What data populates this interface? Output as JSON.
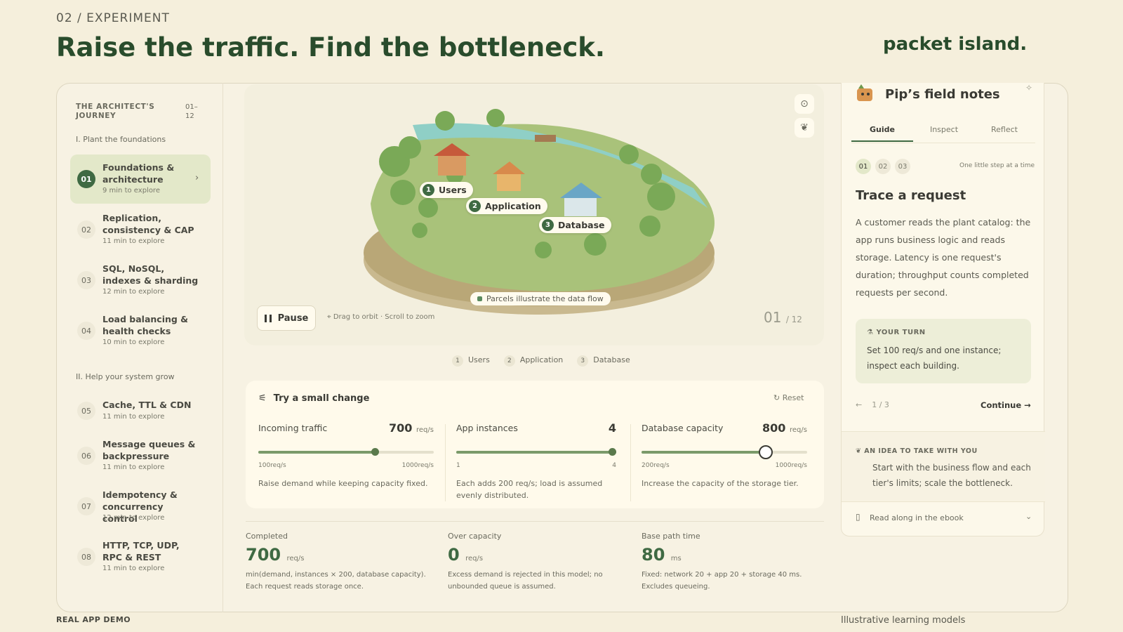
{
  "header": {
    "kicker": "02 / EXPERIMENT",
    "headline": "Raise the traffic. Find the bottleneck.",
    "brand": "packet island."
  },
  "sidebar": {
    "title": "THE ARCHITECT'S JOURNEY",
    "count": "01–12",
    "sections": [
      {
        "label": "I. Plant the foundations"
      },
      {
        "label": "II. Help your system grow"
      }
    ],
    "lessons": [
      {
        "num": "01",
        "title": "Foundations & architecture",
        "time": "9 min to explore",
        "active": true
      },
      {
        "num": "02",
        "title": "Replication, consistency & CAP",
        "time": "11 min to explore"
      },
      {
        "num": "03",
        "title": "SQL, NoSQL, indexes & sharding",
        "time": "12 min to explore"
      },
      {
        "num": "04",
        "title": "Load balancing & health checks",
        "time": "10 min to explore"
      },
      {
        "num": "05",
        "title": "Cache, TTL & CDN",
        "time": "11 min to explore"
      },
      {
        "num": "06",
        "title": "Message queues & backpressure",
        "time": "11 min to explore"
      },
      {
        "num": "07",
        "title": "Idempotency & concurrency control",
        "time": "12 min to explore"
      },
      {
        "num": "08",
        "title": "HTTP, TCP, UDP, RPC & REST",
        "time": "11 min to explore"
      }
    ]
  },
  "scene": {
    "tags": [
      {
        "num": "1",
        "label": "Users"
      },
      {
        "num": "2",
        "label": "Application"
      },
      {
        "num": "3",
        "label": "Database"
      }
    ],
    "flow_note": "Parcels illustrate the data flow",
    "pause_label": "Pause",
    "hint": "Drag to orbit · Scroll to zoom",
    "page_current": "01",
    "page_total": "/ 12",
    "icons": [
      "focus-icon",
      "leaf-icon",
      "pause-icon"
    ]
  },
  "legend": [
    {
      "num": "1",
      "label": "Users"
    },
    {
      "num": "2",
      "label": "Application"
    },
    {
      "num": "3",
      "label": "Database"
    }
  ],
  "controls": {
    "title": "Try a small change",
    "reset": "Reset",
    "sliders": [
      {
        "label": "Incoming traffic",
        "value": "700",
        "unit": "req/s",
        "min": "100req/s",
        "max": "1000req/s",
        "fraction": 0.667,
        "desc": "Raise demand while keeping capacity fixed."
      },
      {
        "label": "App instances",
        "value": "4",
        "unit": "",
        "min": "1",
        "max": "4",
        "fraction": 1.0,
        "desc": "Each adds 200 req/s; load is assumed evenly distributed."
      },
      {
        "label": "Database capacity",
        "value": "800",
        "unit": "req/s",
        "min": "200req/s",
        "max": "1000req/s",
        "fraction": 0.75,
        "desc": "Increase the capacity of the storage tier."
      }
    ]
  },
  "stats": [
    {
      "label": "Completed",
      "value": "700",
      "unit": "req/s",
      "desc": "min(demand, instances × 200, database capacity). Each request reads storage once."
    },
    {
      "label": "Over capacity",
      "value": "0",
      "unit": "req/s",
      "desc": "Excess demand is rejected in this model; no unbounded queue is assumed."
    },
    {
      "label": "Base path time",
      "value": "80",
      "unit": "ms",
      "desc": "Fixed: network 20 + app 20 + storage 40 ms. Excludes queueing."
    }
  ],
  "notes": {
    "title": "Pip’s field notes",
    "tabs": [
      "Guide",
      "Inspect",
      "Reflect"
    ],
    "active_tab": "Guide",
    "steps": [
      "01",
      "02",
      "03"
    ],
    "step_tagline": "One little step at a time",
    "heading": "Trace a request",
    "body": "A customer reads the plant catalog: the app runs business logic and reads storage. Latency is one request's duration; throughput counts completed requests per second.",
    "your_turn_label": "YOUR TURN",
    "your_turn_text": "Set 100 req/s and one instance; inspect each building.",
    "pager": "1 / 3",
    "continue": "Continue",
    "idea_label": "AN IDEA TO TAKE WITH YOU",
    "idea_text": "Start with the business flow and each tier's limits; scale the bottleneck.",
    "ebook": "Read along in the ebook"
  },
  "footer": {
    "left": "REAL APP DEMO",
    "right": "Illustrative learning models"
  },
  "colors": {
    "background": "#f5efdc",
    "accent": "#3f6a43",
    "water": "#8fcfc6",
    "grass": "#a9c27a"
  }
}
